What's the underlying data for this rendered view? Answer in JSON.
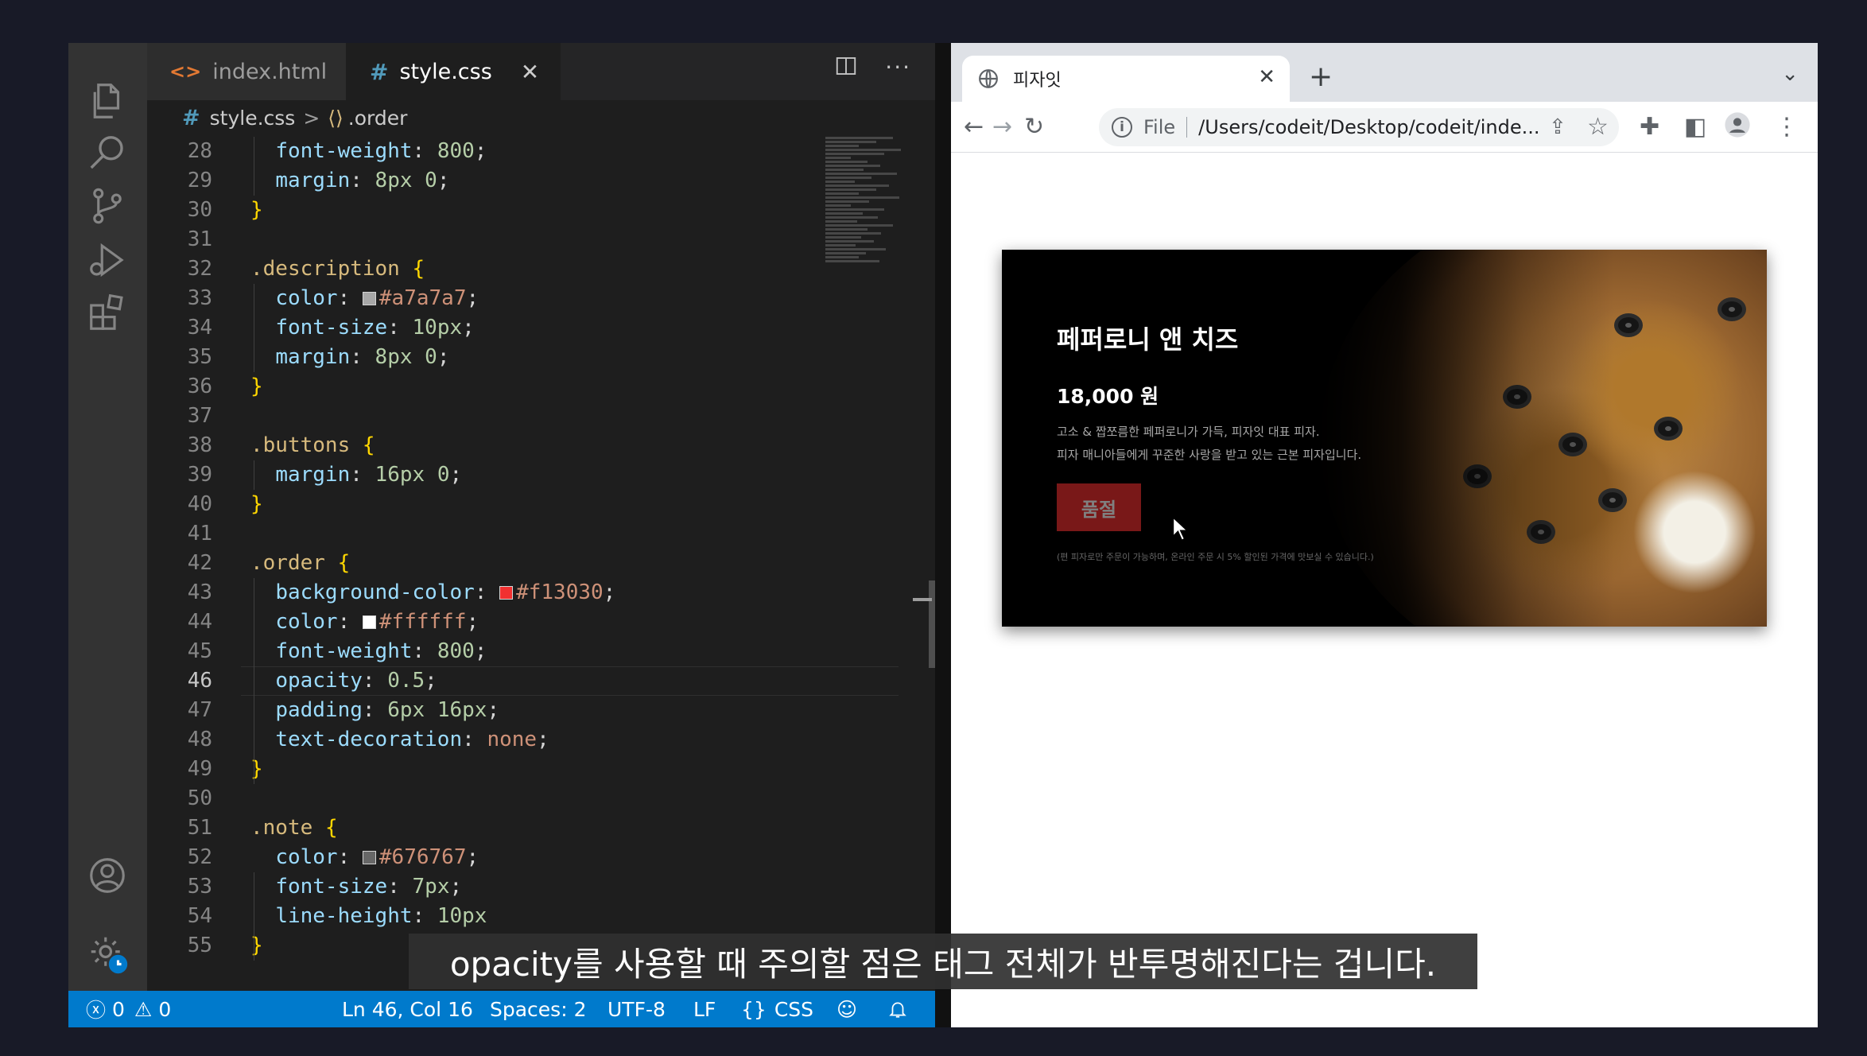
{
  "vscode": {
    "tabs": [
      {
        "label": "index.html"
      },
      {
        "label": "style.css"
      }
    ],
    "breadcrumb": {
      "file": "style.css",
      "separator": ">",
      "symbol": ".order"
    },
    "active_line": 46,
    "statusbar": {
      "errors": "0",
      "warnings": "0",
      "position": "Ln 46, Col 16",
      "spaces": "Spaces: 2",
      "encoding": "UTF-8",
      "eol": "LF",
      "language": "CSS"
    },
    "code_lines": [
      {
        "n": "28",
        "tokens": [
          {
            "t": "  "
          },
          {
            "t": "font-weight",
            "c": "prop"
          },
          {
            "t": ": "
          },
          {
            "t": "800",
            "c": "num"
          },
          {
            "t": ";"
          }
        ]
      },
      {
        "n": "29",
        "tokens": [
          {
            "t": "  "
          },
          {
            "t": "margin",
            "c": "prop"
          },
          {
            "t": ": "
          },
          {
            "t": "8px",
            "c": "num"
          },
          {
            "t": " "
          },
          {
            "t": "0",
            "c": "num"
          },
          {
            "t": ";"
          }
        ]
      },
      {
        "n": "30",
        "tokens": [
          {
            "t": "}",
            "c": "brace"
          }
        ]
      },
      {
        "n": "31",
        "tokens": []
      },
      {
        "n": "32",
        "tokens": [
          {
            "t": ".description",
            "c": "sel"
          },
          {
            "t": " "
          },
          {
            "t": "{",
            "c": "brace"
          }
        ]
      },
      {
        "n": "33",
        "tokens": [
          {
            "t": "  "
          },
          {
            "t": "color",
            "c": "prop"
          },
          {
            "t": ": "
          },
          {
            "swatch": "#a7a7a7"
          },
          {
            "t": "#a7a7a7",
            "c": "val"
          },
          {
            "t": ";"
          }
        ]
      },
      {
        "n": "34",
        "tokens": [
          {
            "t": "  "
          },
          {
            "t": "font-size",
            "c": "prop"
          },
          {
            "t": ": "
          },
          {
            "t": "10px",
            "c": "num"
          },
          {
            "t": ";"
          }
        ]
      },
      {
        "n": "35",
        "tokens": [
          {
            "t": "  "
          },
          {
            "t": "margin",
            "c": "prop"
          },
          {
            "t": ": "
          },
          {
            "t": "8px",
            "c": "num"
          },
          {
            "t": " "
          },
          {
            "t": "0",
            "c": "num"
          },
          {
            "t": ";"
          }
        ]
      },
      {
        "n": "36",
        "tokens": [
          {
            "t": "}",
            "c": "brace"
          }
        ]
      },
      {
        "n": "37",
        "tokens": []
      },
      {
        "n": "38",
        "tokens": [
          {
            "t": ".buttons",
            "c": "sel"
          },
          {
            "t": " "
          },
          {
            "t": "{",
            "c": "brace"
          }
        ]
      },
      {
        "n": "39",
        "tokens": [
          {
            "t": "  "
          },
          {
            "t": "margin",
            "c": "prop"
          },
          {
            "t": ": "
          },
          {
            "t": "16px",
            "c": "num"
          },
          {
            "t": " "
          },
          {
            "t": "0",
            "c": "num"
          },
          {
            "t": ";"
          }
        ]
      },
      {
        "n": "40",
        "tokens": [
          {
            "t": "}",
            "c": "brace"
          }
        ]
      },
      {
        "n": "41",
        "tokens": []
      },
      {
        "n": "42",
        "tokens": [
          {
            "t": ".order",
            "c": "sel"
          },
          {
            "t": " "
          },
          {
            "t": "{",
            "c": "brace"
          }
        ]
      },
      {
        "n": "43",
        "tokens": [
          {
            "t": "  "
          },
          {
            "t": "background-color",
            "c": "prop"
          },
          {
            "t": ": "
          },
          {
            "swatch": "#f13030"
          },
          {
            "t": "#f13030",
            "c": "val"
          },
          {
            "t": ";"
          }
        ]
      },
      {
        "n": "44",
        "tokens": [
          {
            "t": "  "
          },
          {
            "t": "color",
            "c": "prop"
          },
          {
            "t": ": "
          },
          {
            "swatch": "#ffffff"
          },
          {
            "t": "#ffffff",
            "c": "val"
          },
          {
            "t": ";"
          }
        ]
      },
      {
        "n": "45",
        "tokens": [
          {
            "t": "  "
          },
          {
            "t": "font-weight",
            "c": "prop"
          },
          {
            "t": ": "
          },
          {
            "t": "800",
            "c": "num"
          },
          {
            "t": ";"
          }
        ]
      },
      {
        "n": "46",
        "tokens": [
          {
            "t": "  "
          },
          {
            "t": "opacity",
            "c": "prop"
          },
          {
            "t": ": "
          },
          {
            "t": "0.5",
            "c": "num"
          },
          {
            "t": ";"
          }
        ]
      },
      {
        "n": "47",
        "tokens": [
          {
            "t": "  "
          },
          {
            "t": "padding",
            "c": "prop"
          },
          {
            "t": ": "
          },
          {
            "t": "6px",
            "c": "num"
          },
          {
            "t": " "
          },
          {
            "t": "16px",
            "c": "num"
          },
          {
            "t": ";"
          }
        ]
      },
      {
        "n": "48",
        "tokens": [
          {
            "t": "  "
          },
          {
            "t": "text-decoration",
            "c": "prop"
          },
          {
            "t": ": "
          },
          {
            "t": "none",
            "c": "val"
          },
          {
            "t": ";"
          }
        ]
      },
      {
        "n": "49",
        "tokens": [
          {
            "t": "}",
            "c": "brace"
          }
        ]
      },
      {
        "n": "50",
        "tokens": []
      },
      {
        "n": "51",
        "tokens": [
          {
            "t": ".note",
            "c": "sel"
          },
          {
            "t": " "
          },
          {
            "t": "{",
            "c": "brace"
          }
        ]
      },
      {
        "n": "52",
        "tokens": [
          {
            "t": "  "
          },
          {
            "t": "color",
            "c": "prop"
          },
          {
            "t": ": "
          },
          {
            "swatch": "#676767"
          },
          {
            "t": "#676767",
            "c": "val"
          },
          {
            "t": ";"
          }
        ]
      },
      {
        "n": "53",
        "tokens": [
          {
            "t": "  "
          },
          {
            "t": "font-size",
            "c": "prop"
          },
          {
            "t": ": "
          },
          {
            "t": "7px",
            "c": "num"
          },
          {
            "t": ";"
          }
        ]
      },
      {
        "n": "54",
        "tokens": [
          {
            "t": "  "
          },
          {
            "t": "line-height",
            "c": "prop"
          },
          {
            "t": ": "
          },
          {
            "t": "10px",
            "c": "num"
          }
        ]
      },
      {
        "n": "55",
        "tokens": [
          {
            "t": "}",
            "c": "brace"
          }
        ]
      }
    ]
  },
  "browser": {
    "tab_title": "피자잇",
    "omnibox": {
      "scheme_label": "File",
      "url": "/Users/codeit/Desktop/codeit/inde..."
    },
    "page": {
      "title": "페퍼로니 앤 치즈",
      "price": "18,000 원",
      "description_line1": "고소 & 짭쪼름한 페퍼로니가 가득, 피자잇 대표 피자.",
      "description_line2": "피자 매니아들에게 꾸준한 사랑을 받고 있는 근본 피자입니다.",
      "order_button": "품절",
      "order_opacity": 0.5,
      "note": "(편 피자로만 주문이 가능하며, 온라인 주문 시 5% 할인된 가격에 맛보실 수 있습니다.)"
    }
  },
  "subtitle": "opacity를 사용할 때 주의할 점은 태그 전체가 반투명해진다는 겁니다."
}
